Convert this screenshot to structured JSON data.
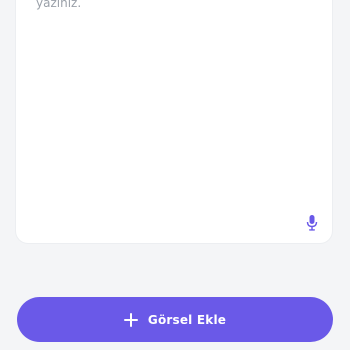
{
  "text_area": {
    "prompt_text": "yazınız."
  },
  "mic": {
    "icon": "microphone-icon",
    "color": "#6a59e8"
  },
  "add_image_button": {
    "label": "Görsel Ekle",
    "icon": "plus-icon",
    "background": "#6a59e8"
  }
}
